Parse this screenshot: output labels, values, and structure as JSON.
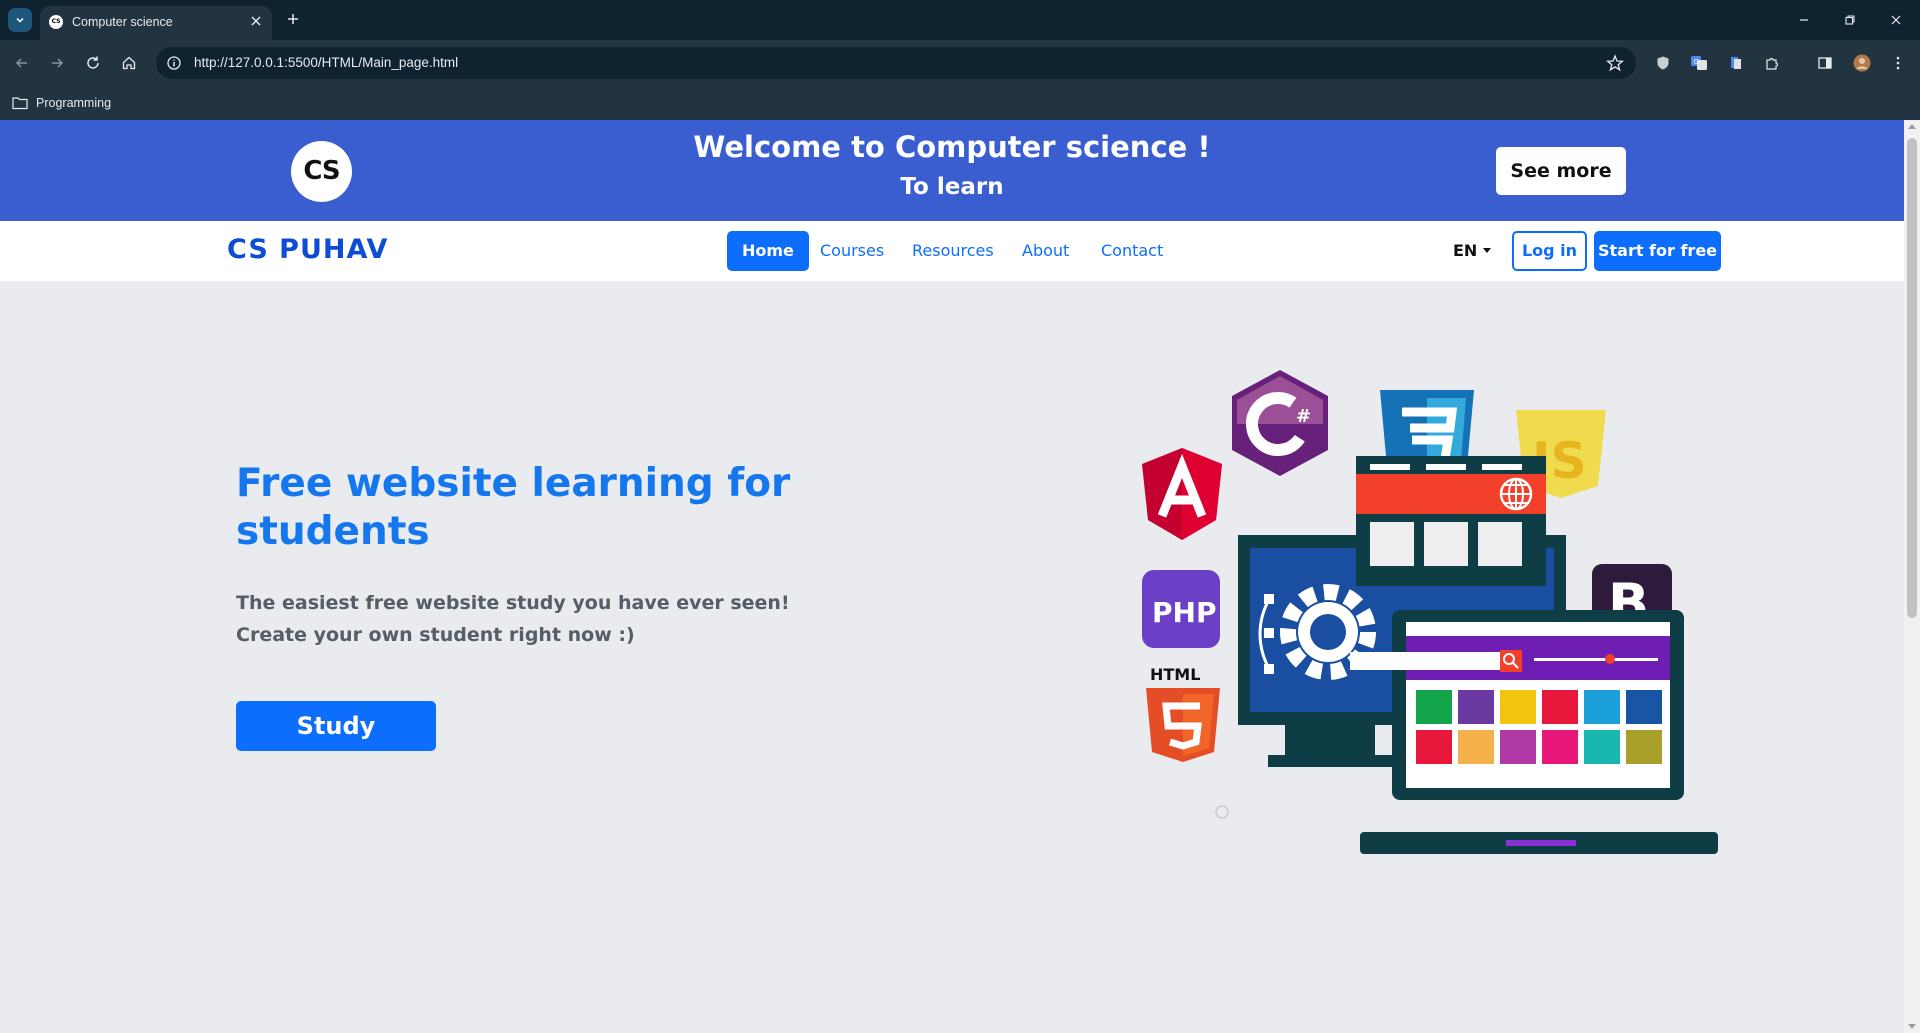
{
  "browser": {
    "tab_title": "Computer science",
    "tab_favicon_text": "CS",
    "url": "http://127.0.0.1:5500/HTML/Main_page.html",
    "bookmark_label": "Programming"
  },
  "banner": {
    "logo_text": "CS",
    "title": "Welcome to Computer science !",
    "subtitle": "To learn",
    "see_more_label": "See more"
  },
  "navbar": {
    "brand": "CS PUHAV",
    "items": [
      {
        "label": "Home",
        "active": true
      },
      {
        "label": "Courses"
      },
      {
        "label": "Resources"
      },
      {
        "label": "About"
      },
      {
        "label": "Contact"
      }
    ],
    "language": "EN",
    "login_label": "Log in",
    "start_label": "Start for free"
  },
  "hero": {
    "title": "Free website learning for students",
    "line1": "The easiest free website study you have ever seen!",
    "line2": "Create your own student right now :)",
    "study_label": "Study"
  },
  "illustration": {
    "icons": [
      "angular-logo-icon",
      "csharp-logo-icon",
      "css3-logo-icon",
      "javascript-logo-icon",
      "php-logo-icon",
      "html5-logo-icon",
      "bootstrap-logo-icon",
      "laptop-icon",
      "monitor-icon",
      "gear-icon",
      "globe-icon"
    ],
    "php_text": "PHP",
    "html_text": "HTML",
    "bootstrap_text": "B",
    "js_text": "JS",
    "colors": {
      "banner": "#3a5ecf",
      "primary": "#0d6efd",
      "background": "#e9ebee"
    }
  }
}
